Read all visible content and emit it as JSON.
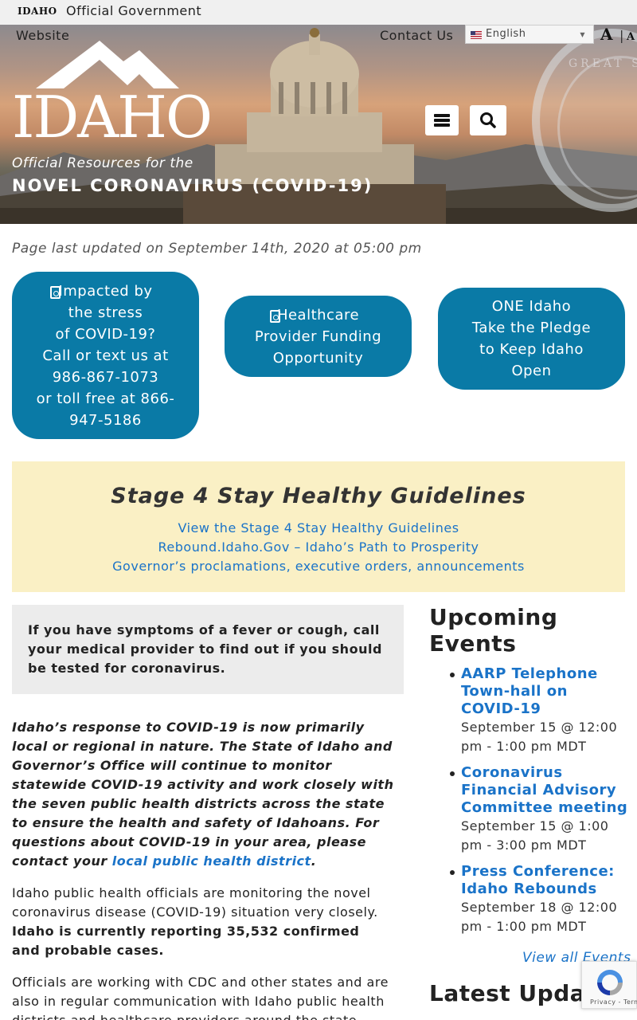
{
  "topbar": {
    "logo_text": "IDAHO",
    "official_text": "Official Government",
    "website_text": "Website"
  },
  "nav": {
    "contact": "Contact Us",
    "language": "English",
    "font_large": "A",
    "font_sep": "|",
    "font_small": "A"
  },
  "hero": {
    "logo_word": "IDAHO",
    "tagline": "Official Resources for the",
    "headline": "NOVEL CORONAVIRUS (COVID-19)"
  },
  "updated": "Page last updated on September 14th, 2020 at 05:00 pm",
  "buttons": [
    {
      "label": "Impacted by the stress of COVID-19? Call or text us at 986-867-1073 or toll free at 866-947-5186",
      "lines": "Impacted by\nthe stress\nof COVID-19?\nCall or text us at\n986-867-1073\nor toll free at 866-\n947-5186"
    },
    {
      "label": "Healthcare Provider Funding Opportunity",
      "lines": "Healthcare\nProvider Funding\nOpportunity"
    },
    {
      "label": "ONE Idaho Take the Pledge to Keep Idaho Open",
      "lines": "ONE Idaho\nTake the Pledge\nto Keep Idaho\nOpen"
    }
  ],
  "alert": {
    "title": "Stage 4 Stay Healthy Guidelines",
    "links": [
      "View the Stage 4 Stay Healthy Guidelines",
      "Rebound.Idaho.Gov – Idaho’s Path to Prosperity",
      "Governor’s proclamations, executive orders, announcements"
    ]
  },
  "symptoms": "If you have symptoms of a fever or cough, call your medical provider to find out if you should be tested for coronavirus.",
  "response": {
    "text": "Idaho’s response to COVID-19 is now primarily local or regional in nature. The State of Idaho and Governor’s Office will continue to monitor statewide COVID-19 activity and work closely with the seven public health districts across the state to ensure the health and safety of Idahoans. For questions about COVID-19 in your area, please contact your ",
    "link": "local public health district",
    "end": "."
  },
  "monitoring": {
    "text": "Idaho public health officials are monitoring the novel coronavirus disease (COVID-19) situation very closely. ",
    "bold": "Idaho is currently reporting 35,532 confirmed and probable cases."
  },
  "officials": "Officials are working with CDC and other states and are also in regular communication with Idaho public health districts and healthcare providers around the state.",
  "events": {
    "title": "Upcoming Events",
    "items": [
      {
        "title": "AARP Telephone Town-hall on COVID-19",
        "date": "September 15 @ 12:00 pm - 1:00 pm MDT"
      },
      {
        "title": "Coronavirus Financial Advisory Committee meeting",
        "date": "September 15 @ 1:00 pm - 3:00 pm MDT"
      },
      {
        "title": "Press Conference: Idaho Rebounds",
        "date": "September 18 @ 12:00 pm - 1:00 pm MDT"
      }
    ],
    "view_all": "View all Events"
  },
  "latest_title": "Latest Updates",
  "recaptcha": "Privacy - Terms",
  "colors": {
    "primary": "#0a7aa6",
    "link": "#1a73c8",
    "alert_bg": "#faf0c5",
    "box_bg": "#ececec"
  }
}
